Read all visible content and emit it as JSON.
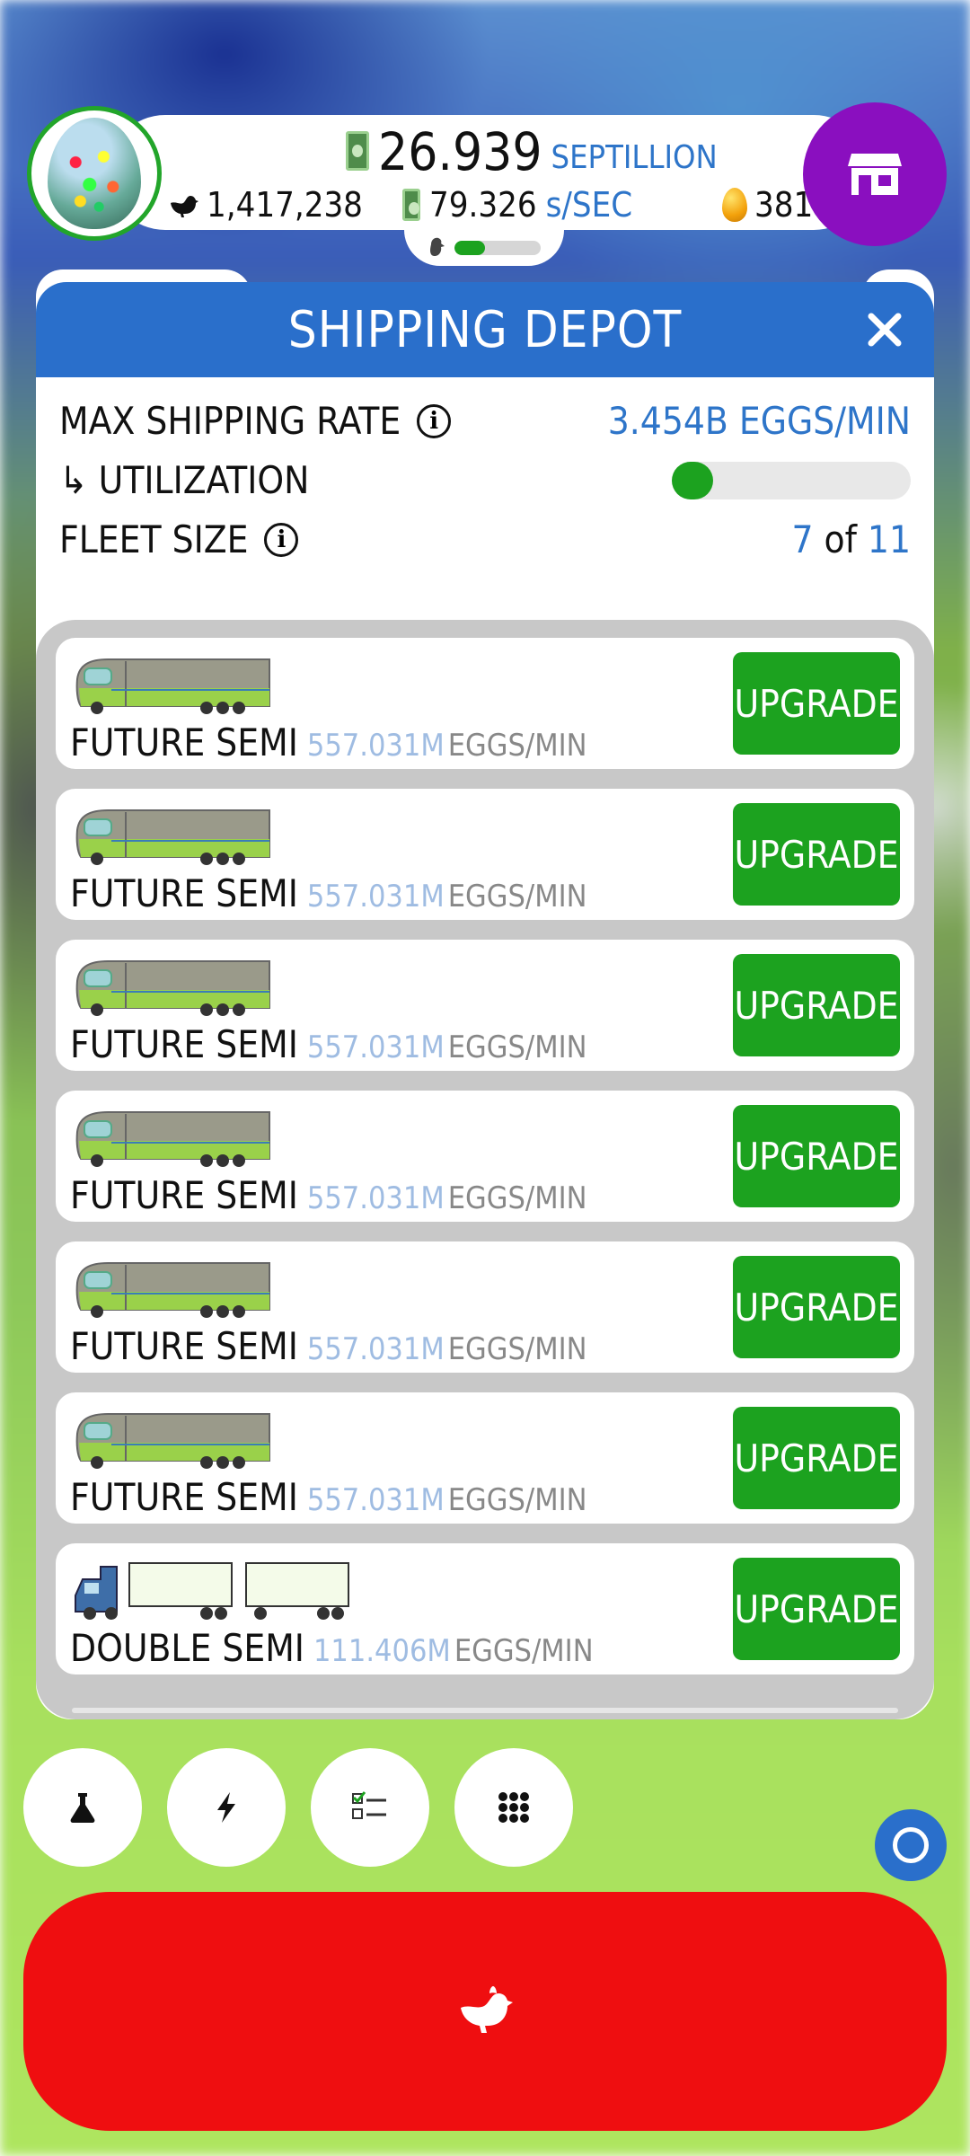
{
  "hud": {
    "money_value": "26.939",
    "money_unit": "SEPTILLION",
    "chicken_count": "1,417,238",
    "earning_rate_value": "79.326",
    "earning_rate_unit": "s/SEC",
    "golden_eggs": "381",
    "habitat_fill_fraction": 0.35
  },
  "dialog": {
    "title": "SHIPPING DEPOT",
    "max_shipping_rate_label": "MAX SHIPPING RATE",
    "max_shipping_rate_value": "3.454B EGGS/MIN",
    "utilization_label": "↳ UTILIZATION",
    "utilization_fraction": 0.05,
    "fleet_size_label": "FLEET SIZE",
    "fleet_current": "7",
    "fleet_of": "of",
    "fleet_max": "11"
  },
  "vehicles": [
    {
      "name": "FUTURE SEMI",
      "capacity": "557.031M",
      "units": "EGGS/MIN",
      "button": "UPGRADE",
      "kind": "future"
    },
    {
      "name": "FUTURE SEMI",
      "capacity": "557.031M",
      "units": "EGGS/MIN",
      "button": "UPGRADE",
      "kind": "future"
    },
    {
      "name": "FUTURE SEMI",
      "capacity": "557.031M",
      "units": "EGGS/MIN",
      "button": "UPGRADE",
      "kind": "future"
    },
    {
      "name": "FUTURE SEMI",
      "capacity": "557.031M",
      "units": "EGGS/MIN",
      "button": "UPGRADE",
      "kind": "future"
    },
    {
      "name": "FUTURE SEMI",
      "capacity": "557.031M",
      "units": "EGGS/MIN",
      "button": "UPGRADE",
      "kind": "future"
    },
    {
      "name": "FUTURE SEMI",
      "capacity": "557.031M",
      "units": "EGGS/MIN",
      "button": "UPGRADE",
      "kind": "future"
    },
    {
      "name": "DOUBLE SEMI",
      "capacity": "111.406M",
      "units": "EGGS/MIN",
      "button": "UPGRADE",
      "kind": "double"
    }
  ],
  "bottom_bar": {
    "buttons": [
      "flask-icon",
      "lightning-icon",
      "checklist-icon",
      "grid-icon"
    ]
  },
  "colors": {
    "accent_blue": "#2a6fcb",
    "upgrade_green": "#1ca21f",
    "hatch_red": "#ef0e10",
    "shop_purple": "#8a0fbf"
  }
}
